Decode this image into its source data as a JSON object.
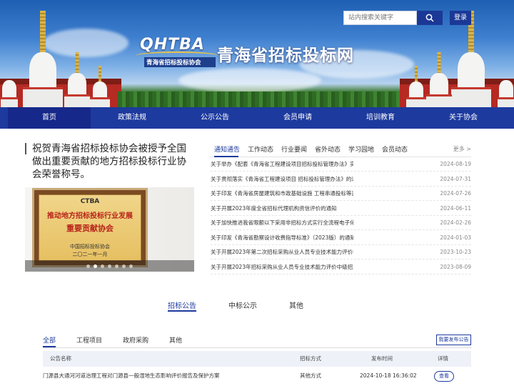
{
  "header": {
    "logo_text": "QHTBA",
    "logo_subtitle": "青海省招标投标协会",
    "site_title": "青海省招标投标网",
    "search_placeholder": "站内搜索关键字",
    "login_label": "登录"
  },
  "nav": {
    "items": [
      "首页",
      "政策法规",
      "公示公告",
      "会员申请",
      "培训教育",
      "关于协会"
    ],
    "active_index": 0
  },
  "feature": {
    "title": "祝贺青海省招标投标协会被授予全国做出重要贡献的地方招标投标行业协会荣誉称号。",
    "plaque": {
      "logo": "CTBA",
      "line1": "推动地方招标投标行业发展",
      "line2": "重要贡献协会",
      "line3": "中国招标投标协会",
      "line4": "二〇二一年一月"
    },
    "slide_count": 7,
    "active_slide": 1
  },
  "notices": {
    "tabs": [
      "通知通告",
      "工作动态",
      "行业要闻",
      "省外动态",
      "学习园地",
      "会员动态"
    ],
    "active_tab": 0,
    "more_label": "更多 >",
    "items": [
      {
        "title": "关于举办《配套《青海省工程建设项目招标投标管理办法》实...",
        "date": "2024-08-19"
      },
      {
        "title": "关于贯彻落实《青海省工程建设项目 招标投标管理办法》的通知",
        "date": "2024-07-31"
      },
      {
        "title": "关于印发《青海省房屋建筑和市政基础设施 工程串通投标等违...",
        "date": "2024-07-26"
      },
      {
        "title": "关于开展2023年度全省招标代理机构资信评价的通知",
        "date": "2024-06-11"
      },
      {
        "title": "关于加快推进我省限额以下采用非招标方式实行全流程电子化...",
        "date": "2024-02-26"
      },
      {
        "title": "关于印发《青海省勘察设计收费指导标准》（2023版）的通知",
        "date": "2024-01-03"
      },
      {
        "title": "关于开展2023年第二次招标采购从业人员专业技术能力评价初...",
        "date": "2023-10-23"
      },
      {
        "title": "关于开展2023年招标采购从业人员专业技术能力评价中级招采...",
        "date": "2023-08-09"
      }
    ]
  },
  "announcements": {
    "main_tabs": [
      "招标公告",
      "中标公示",
      "其他"
    ],
    "active_main_tab": 0,
    "categories": [
      "全部",
      "工程项目",
      "政府采购",
      "其他"
    ],
    "active_category": 0,
    "publish_label": "我要发布公告",
    "columns": [
      "公告名称",
      "招标方式",
      "发布时间",
      "详情"
    ],
    "rows": [
      {
        "name": "门源县大通河河道治理工程对门源县一般湿地生态影响评价报告及保护方案",
        "method": "其他方式",
        "time": "2024-10-18 16:36:02",
        "action": "查看"
      }
    ]
  },
  "colors": {
    "nav_blue": "#1d3a9e",
    "accent": "#1d3a9e"
  }
}
